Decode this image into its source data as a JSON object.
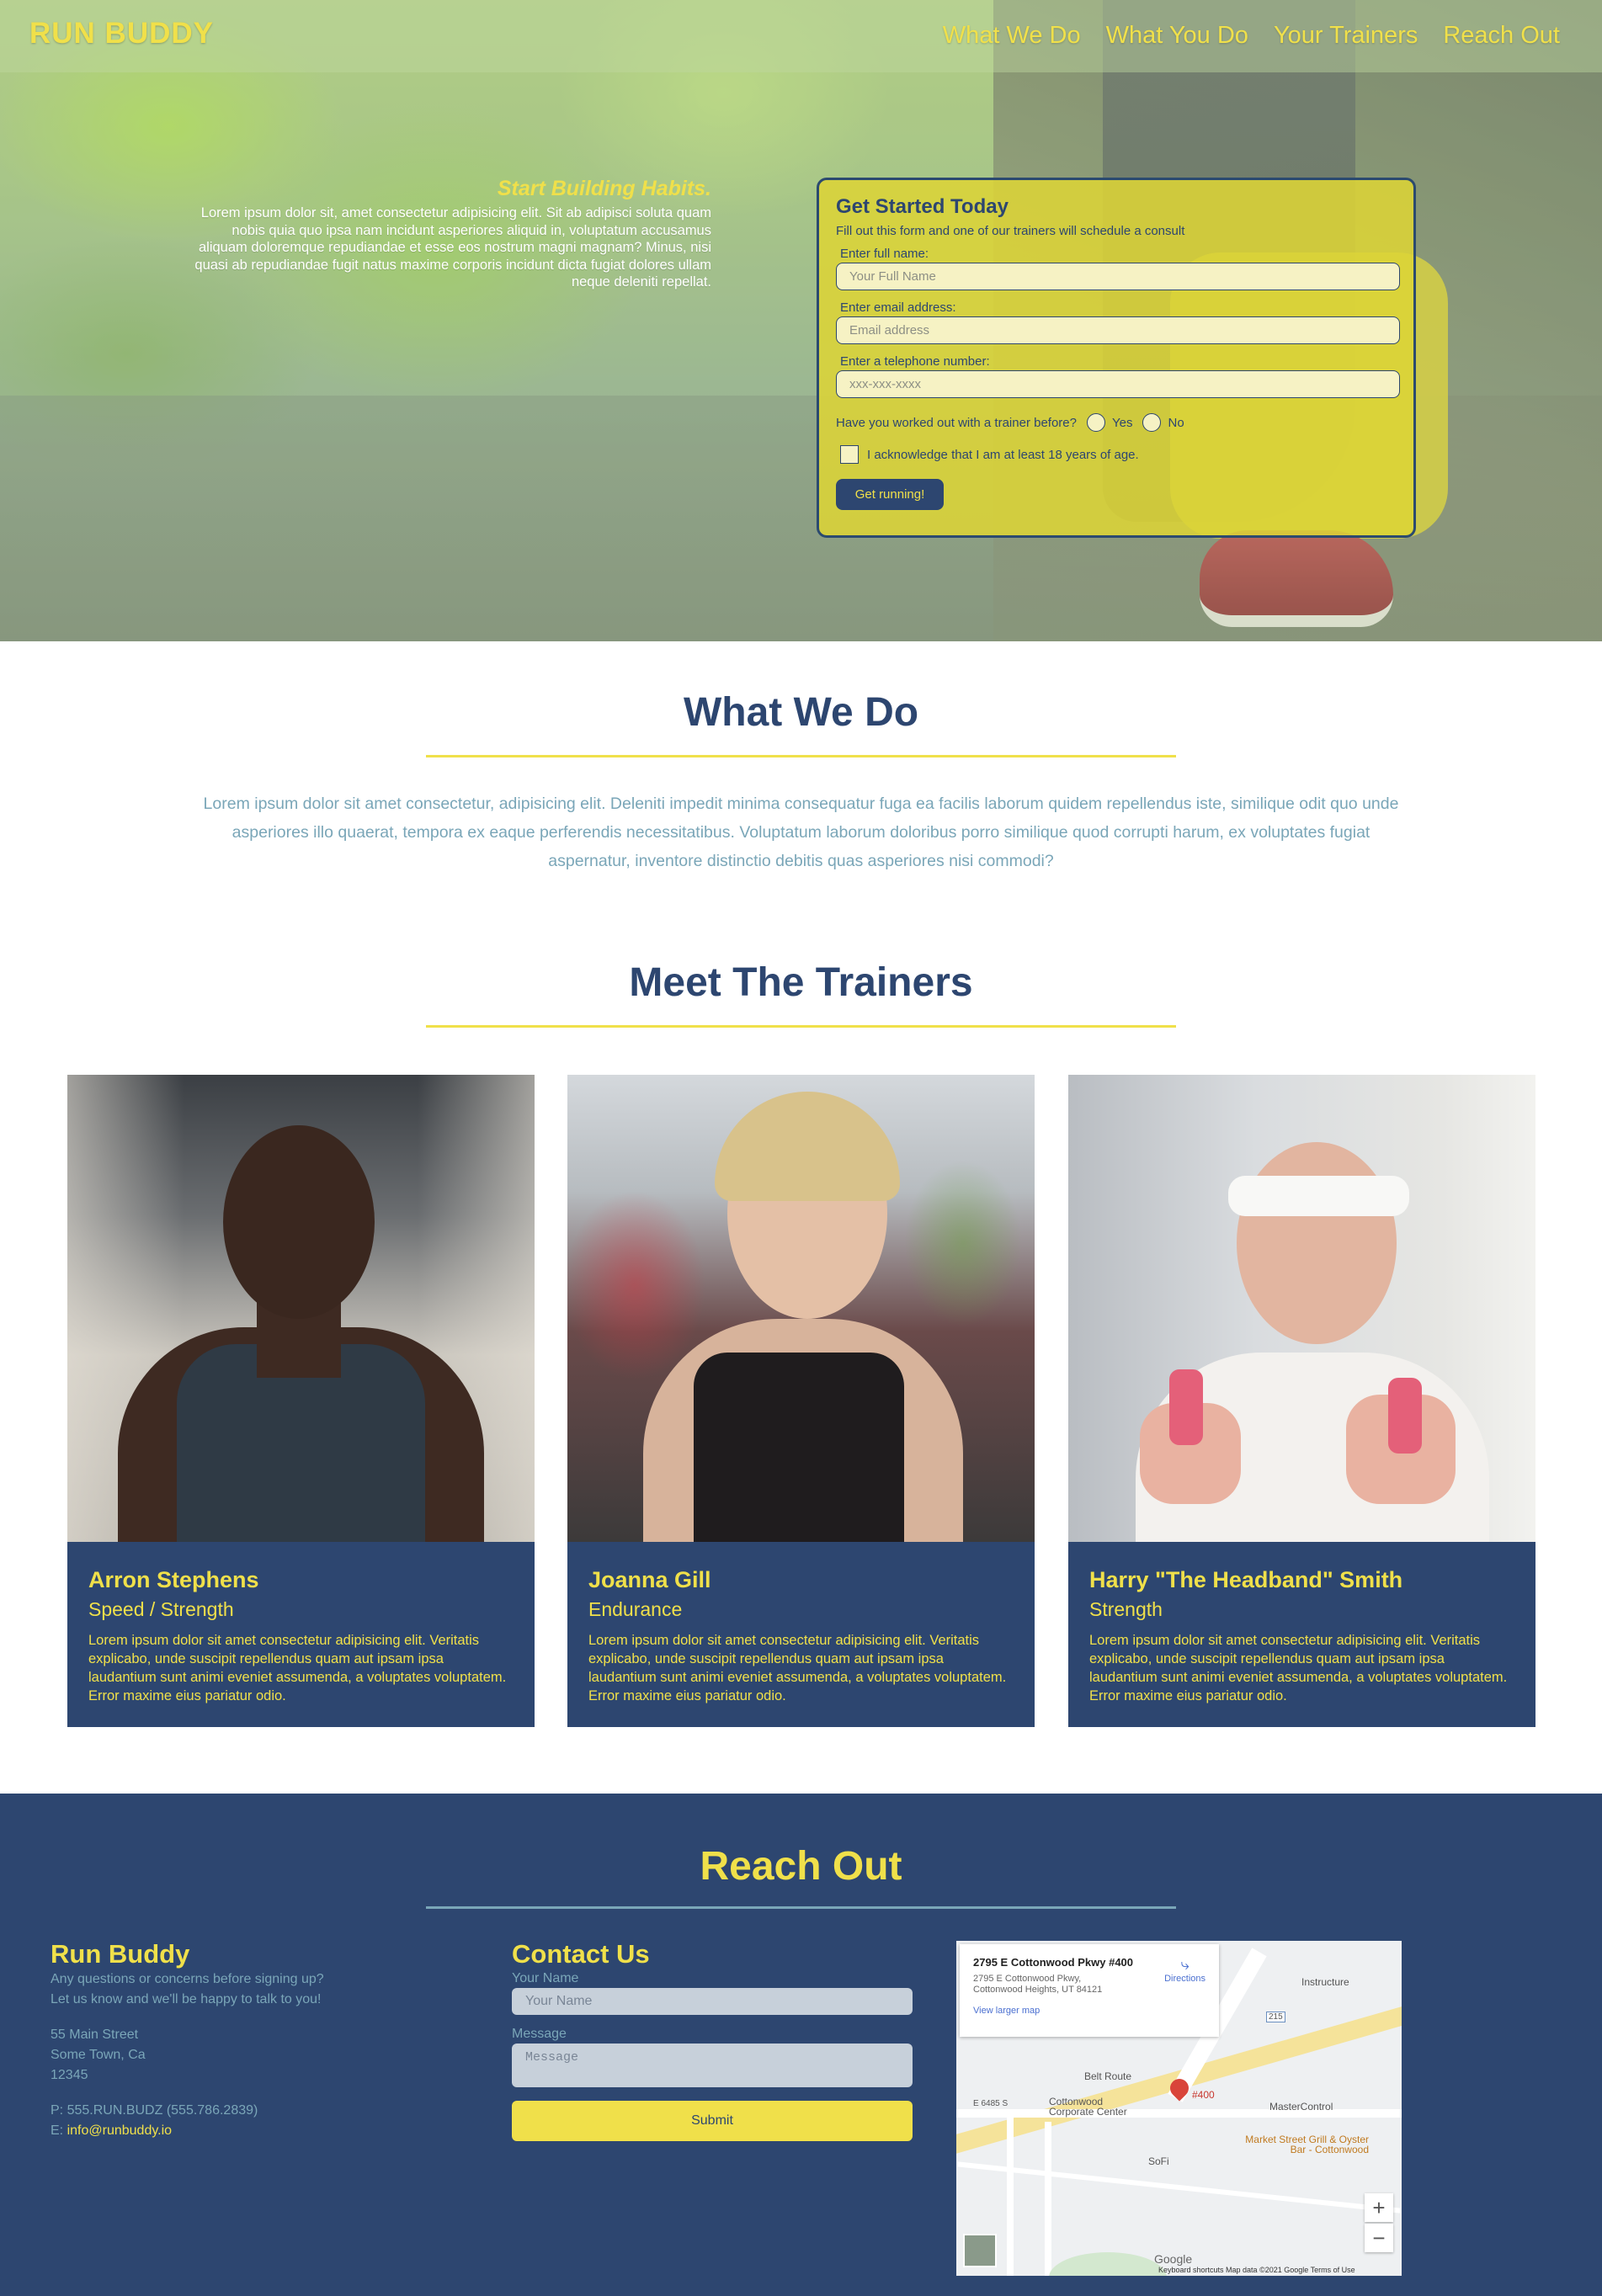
{
  "header": {
    "logo": "RUN BUDDY",
    "nav": [
      "What We Do",
      "What You Do",
      "Your Trainers",
      "Reach Out"
    ]
  },
  "hero": {
    "heading": "Start Building Habits.",
    "paragraph": "Lorem ipsum dolor sit, amet consectetur adipisicing elit. Sit ab adipisci soluta quam nobis quia quo ipsa nam incidunt asperiores aliquid in, voluptatum accusamus aliquam doloremque repudiandae et esse eos nostrum magni magnam? Minus, nisi quasi ab repudiandae fugit natus maxime corporis incidunt dicta fugiat dolores ullam neque deleniti repellat."
  },
  "form": {
    "title": "Get Started Today",
    "subtitle": "Fill out this form and one of our trainers will schedule a consult",
    "name_label": "Enter full name:",
    "name_placeholder": "Your Full Name",
    "email_label": "Enter email address:",
    "email_placeholder": "Email address",
    "phone_label": "Enter a telephone number:",
    "phone_placeholder": "xxx-xxx-xxxx",
    "trainer_question": "Have you worked out with a trainer before?",
    "yes": "Yes",
    "no": "No",
    "ack": "I acknowledge that I am at least 18 years of age.",
    "submit": "Get running!"
  },
  "what_we_do": {
    "title": "What We Do",
    "text": "Lorem ipsum dolor sit amet consectetur, adipisicing elit. Deleniti impedit minima consequatur fuga ea facilis laborum quidem repellendus iste, similique odit quo unde asperiores illo quaerat, tempora ex eaque perferendis necessitatibus. Voluptatum laborum doloribus porro similique quod corrupti harum, ex voluptates fugiat aspernatur, inventore distinctio debitis quas asperiores nisi commodi?"
  },
  "trainers": {
    "title": "Meet The Trainers",
    "items": [
      {
        "name": "Arron Stephens",
        "specialty": "Speed / Strength",
        "bio": "Lorem ipsum dolor sit amet consectetur adipisicing elit. Veritatis explicabo, unde suscipit repellendus quam aut ipsam ipsa laudantium sunt animi eveniet assumenda, a voluptates voluptatem. Error maxime eius pariatur odio."
      },
      {
        "name": "Joanna Gill",
        "specialty": "Endurance",
        "bio": "Lorem ipsum dolor sit amet consectetur adipisicing elit. Veritatis explicabo, unde suscipit repellendus quam aut ipsam ipsa laudantium sunt animi eveniet assumenda, a voluptates voluptatem. Error maxime eius pariatur odio."
      },
      {
        "name": "Harry \"The Headband\" Smith",
        "specialty": "Strength",
        "bio": "Lorem ipsum dolor sit amet consectetur adipisicing elit. Veritatis explicabo, unde suscipit repellendus quam aut ipsam ipsa laudantium sunt animi eveniet assumenda, a voluptates voluptatem. Error maxime eius pariatur odio."
      }
    ]
  },
  "reach_out": {
    "title": "Reach Out",
    "company": {
      "name": "Run Buddy",
      "line1": "Any questions or concerns before signing up?",
      "line2": "Let us know and we'll be happy to talk to you!",
      "street": "55 Main Street",
      "city": "Some Town, Ca",
      "zip": "12345",
      "phone": "P: 555.RUN.BUDZ (555.786.2839)",
      "email_prefix": "E:",
      "email": "info@runbuddy.io"
    },
    "contact": {
      "title": "Contact Us",
      "name_label": "Your Name",
      "name_placeholder": "Your Name",
      "message_label": "Message",
      "message_placeholder": "Message",
      "submit": "Submit"
    },
    "map": {
      "address": "2795 E Cottonwood Pkwy #400",
      "address_line2": "2795 E Cottonwood Pkwy, Cottonwood Heights, UT 84121",
      "directions": "Directions",
      "view_larger": "View larger map",
      "labels": {
        "instructure": "Instructure",
        "belt_route": "Belt Route",
        "pin": "#400",
        "e6485": "E 6485 S",
        "cottonwood": "Cottonwood Corporate Center",
        "mastercontrol": "MasterControl",
        "market": "Market Street Grill & Oyster Bar - Cottonwood",
        "sofi": "SoFi",
        "hwy": "215"
      },
      "zoom_in": "+",
      "zoom_out": "−",
      "google": "Google",
      "footer": "Keyboard shortcuts   Map data ©2021 Google   Terms of Use"
    }
  },
  "colors": {
    "navy": "#2d4670",
    "yellow": "#f0e04a",
    "teal": "#7aa6b8"
  }
}
